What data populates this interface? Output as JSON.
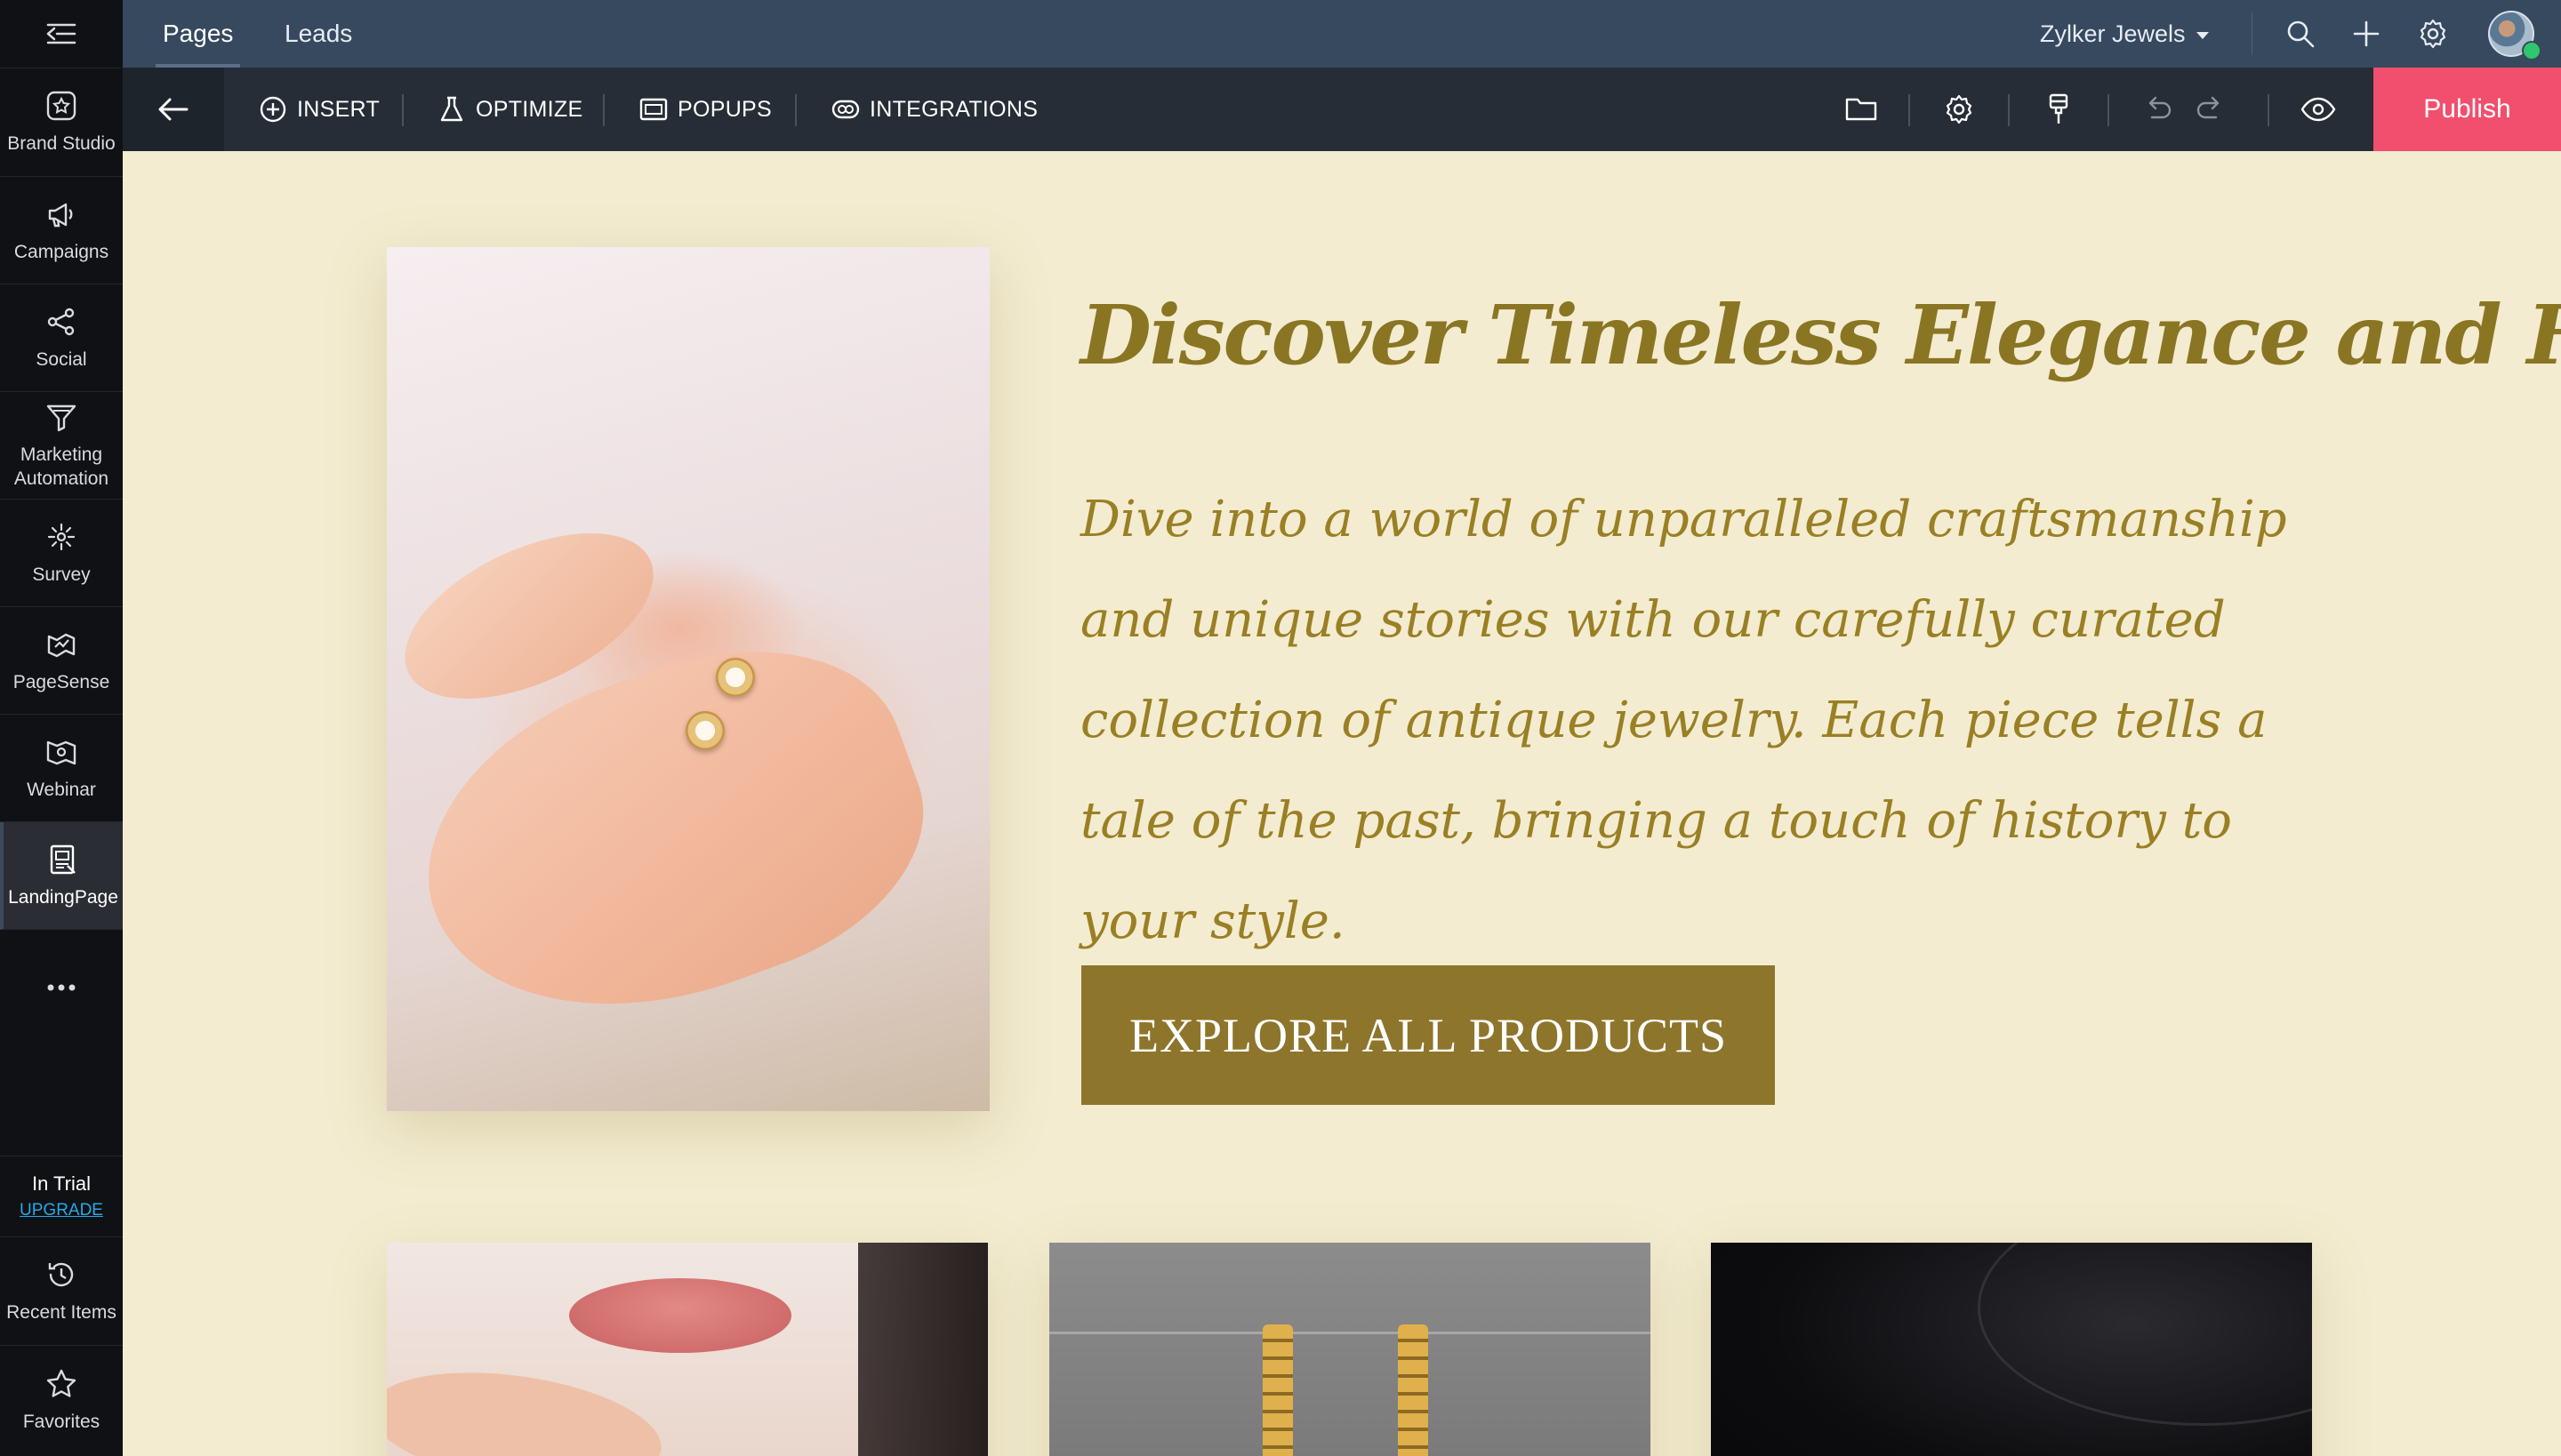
{
  "sidebar": {
    "items": [
      {
        "label": "Brand Studio",
        "icon": "brand-studio-icon"
      },
      {
        "label": "Campaigns",
        "icon": "megaphone-icon"
      },
      {
        "label": "Social",
        "icon": "share-icon"
      },
      {
        "label": "Marketing Automation",
        "icon": "funnel-icon"
      },
      {
        "label": "Survey",
        "icon": "survey-icon"
      },
      {
        "label": "PageSense",
        "icon": "pagesense-icon"
      },
      {
        "label": "Webinar",
        "icon": "webinar-icon"
      },
      {
        "label": "LandingPage",
        "icon": "landing-page-icon",
        "active": true
      }
    ],
    "trial_label": "In Trial",
    "upgrade_label": "UPGRADE",
    "bottom_items": [
      {
        "label": "Recent Items",
        "icon": "history-icon"
      },
      {
        "label": "Favorites",
        "icon": "star-icon"
      }
    ]
  },
  "header": {
    "tabs": [
      {
        "label": "Pages",
        "active": true
      },
      {
        "label": "Leads",
        "active": false
      }
    ],
    "org_name": "Zylker Jewels"
  },
  "toolbar": {
    "items": [
      {
        "label": "INSERT",
        "icon": "plus-circle-icon"
      },
      {
        "label": "OPTIMIZE",
        "icon": "flask-icon"
      },
      {
        "label": "POPUPS",
        "icon": "popup-icon"
      },
      {
        "label": "INTEGRATIONS",
        "icon": "integrations-icon"
      }
    ],
    "publish_label": "Publish"
  },
  "page": {
    "headline": "Discover Timeless Elegance and History",
    "subtext": "Dive into a world of unparalleled craftsmanship and unique stories with our carefully curated collection of antique jewelry. Each piece tells a tale of the past, bringing a touch of history to your style.",
    "cta_label": "EXPLORE ALL PRODUCTS"
  },
  "colors": {
    "sidebar_bg": "#0f1114",
    "header_bg": "#36495f",
    "toolbar_bg": "#262d36",
    "publish": "#f24e6d",
    "canvas_bg": "#f3ecd0",
    "heading_gold": "#8a7523",
    "cta_bg": "#8e752c"
  }
}
